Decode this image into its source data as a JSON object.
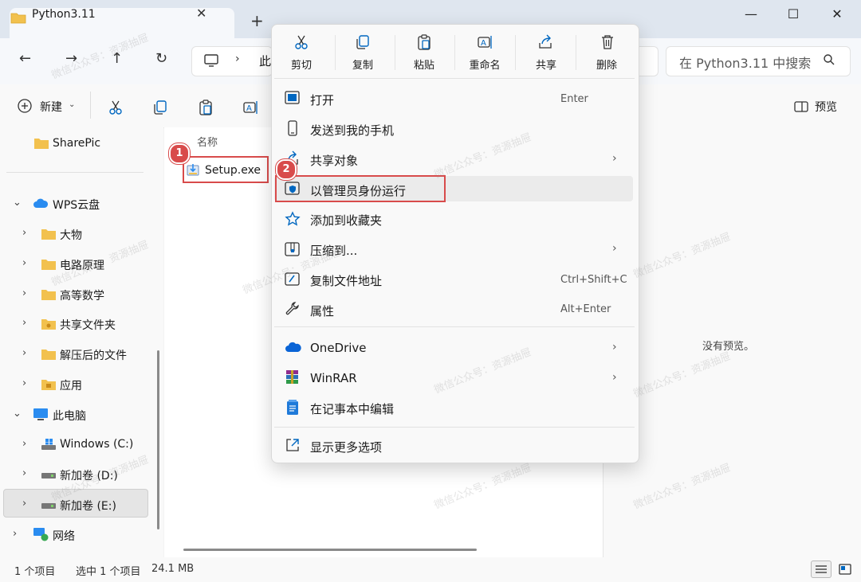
{
  "window": {
    "tab_title": "Python3.11",
    "tab_close": "✕",
    "new_tab": "+",
    "minimize": "—",
    "maximize": "☐",
    "close": "✕"
  },
  "nav": {
    "back": "←",
    "forward": "→",
    "up": "↑",
    "refresh": "↻",
    "addr_chevron": "›",
    "addr_text": "此",
    "search_placeholder": "在 Python3.11 中搜索"
  },
  "commandbar": {
    "new_label": "新建",
    "new_chevron": "⌄",
    "preview_label": "预览"
  },
  "sidebar": {
    "items": [
      {
        "label": "SharePic",
        "chevron": ""
      },
      {
        "label": "WPS云盘",
        "chevron": "⌄"
      },
      {
        "label": "大物",
        "chevron": "›"
      },
      {
        "label": "电路原理",
        "chevron": "›"
      },
      {
        "label": "高等数学",
        "chevron": "›"
      },
      {
        "label": "共享文件夹",
        "chevron": "›"
      },
      {
        "label": "解压后的文件",
        "chevron": "›"
      },
      {
        "label": "应用",
        "chevron": "›"
      },
      {
        "label": "此电脑",
        "chevron": "⌄"
      },
      {
        "label": "Windows (C:)",
        "chevron": "›"
      },
      {
        "label": "新加卷 (D:)",
        "chevron": "›"
      },
      {
        "label": "新加卷 (E:)",
        "chevron": "›"
      },
      {
        "label": "网络",
        "chevron": "›"
      }
    ]
  },
  "content": {
    "column_name": "名称",
    "file_name": "Setup.exe",
    "no_preview": "没有预览。"
  },
  "status": {
    "item_count": "1 个项目",
    "selected": "选中 1 个项目",
    "size": "24.1 MB"
  },
  "badges": {
    "first": "1",
    "second": "2"
  },
  "context_menu": {
    "quick_actions": [
      {
        "label": "剪切"
      },
      {
        "label": "复制"
      },
      {
        "label": "粘贴"
      },
      {
        "label": "重命名"
      },
      {
        "label": "共享"
      },
      {
        "label": "删除"
      }
    ],
    "items": [
      {
        "label": "打开",
        "shortcut": "Enter"
      },
      {
        "label": "发送到我的手机",
        "shortcut": ""
      },
      {
        "label": "共享对象",
        "shortcut": "",
        "arrow": "›"
      },
      {
        "label": "以管理员身份运行",
        "shortcut": ""
      },
      {
        "label": "添加到收藏夹",
        "shortcut": ""
      },
      {
        "label": "压缩到...",
        "shortcut": "",
        "arrow": "›"
      },
      {
        "label": "复制文件地址",
        "shortcut": "Ctrl+Shift+C"
      },
      {
        "label": "属性",
        "shortcut": "Alt+Enter"
      },
      {
        "label": "OneDrive",
        "shortcut": "",
        "arrow": "›"
      },
      {
        "label": "WinRAR",
        "shortcut": "",
        "arrow": "›"
      },
      {
        "label": "在记事本中编辑",
        "shortcut": ""
      },
      {
        "label": "显示更多选项",
        "shortcut": ""
      }
    ]
  },
  "watermark": "微信公众号：资源抽屉",
  "colors": {
    "accent": "#0067c0",
    "highlight": "#d84b4b",
    "folder": "#f2c14e"
  }
}
